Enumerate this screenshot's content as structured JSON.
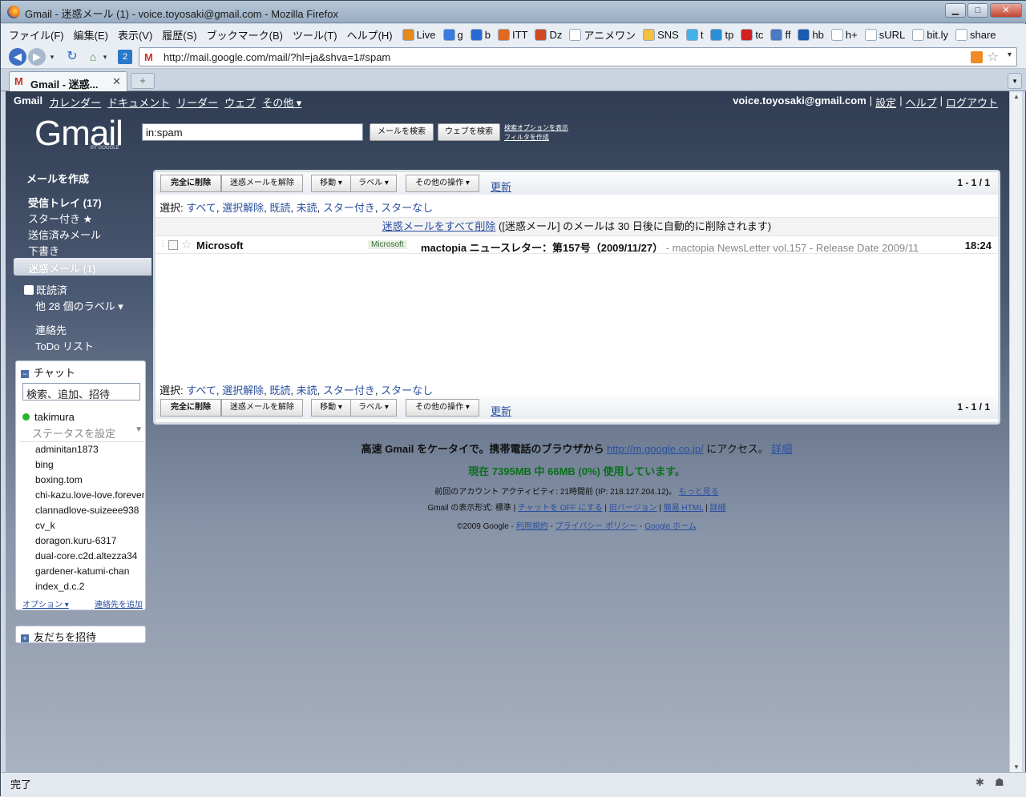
{
  "window": {
    "title": "Gmail - 迷惑メール (1) - voice.toyosaki@gmail.com - Mozilla Firefox",
    "min": "▁",
    "max": "□",
    "close": "✕"
  },
  "menu": {
    "items": [
      "ファイル(F)",
      "編集(E)",
      "表示(V)",
      "履歴(S)",
      "ブックマーク(B)",
      "ツール(T)",
      "ヘルプ(H)"
    ],
    "bookmarks": [
      {
        "label": "Live",
        "color": "#e58a1a"
      },
      {
        "label": "g",
        "color": "#3a7be0"
      },
      {
        "label": "b",
        "color": "#2a6ad6"
      },
      {
        "label": "ITT",
        "color": "#e06a22"
      },
      {
        "label": "Dz",
        "color": "#d04a20"
      },
      {
        "label": "アニメワン",
        "color": "#ffffff"
      },
      {
        "label": "SNS",
        "color": "#f0c040"
      },
      {
        "label": "t",
        "color": "#44b0e8"
      },
      {
        "label": "tp",
        "color": "#2a90d8"
      },
      {
        "label": "tc",
        "color": "#d02020"
      },
      {
        "label": "ff",
        "color": "#4a7ac0"
      },
      {
        "label": "hb",
        "color": "#1a5ab0"
      },
      {
        "label": "h+",
        "color": "#ffffff"
      },
      {
        "label": "sURL",
        "color": "#ffffff"
      },
      {
        "label": "bit.ly",
        "color": "#ffffff"
      },
      {
        "label": "share",
        "color": "#ffffff"
      }
    ]
  },
  "nav": {
    "url": "http://mail.google.com/mail/?hl=ja&shva=1#spam",
    "favicon": "M"
  },
  "tab": {
    "label": "Gmail - 迷惑...",
    "close": "✕",
    "new": "+"
  },
  "gmail": {
    "topnav": [
      "Gmail",
      "カレンダー",
      "ドキュメント",
      "リーダー",
      "ウェブ",
      "その他 ▾"
    ],
    "email": "voice.toyosaki@gmail.com",
    "toplinks": [
      "設定",
      "ヘルプ",
      "ログアウト"
    ],
    "logo": "Gmail",
    "logo_sub": "BY GOOGLE",
    "search_value": "in:spam",
    "search_mail_btn": "メールを検索",
    "search_web_btn": "ウェブを検索",
    "search_options": "検索オプションを表示",
    "create_filter": "フィルタを作成"
  },
  "sidebar": {
    "compose": "メールを作成",
    "inbox": "受信トレイ (17)",
    "starred": "スター付き ★",
    "sent": "送信済みメール",
    "drafts": "下書き",
    "spam": "迷惑メール (1)",
    "label_read": "既読済",
    "more_labels": "他 28 個のラベル ▾",
    "contacts": "連絡先",
    "todo": "ToDo リスト"
  },
  "chat": {
    "title": "チャット",
    "search_value": "検索、追加、招待",
    "me": "takimura",
    "status": "ステータスを設定",
    "contacts": [
      "adminitan1873",
      "bing",
      "boxing.tom",
      "chi-kazu.love-love.forever",
      "clannadlove-suizeee938",
      "cv_k",
      "doragon.kuru-6317",
      "dual-core.c2d.altezza34",
      "gardener-katumi-chan",
      "index_d.c.2"
    ],
    "options": "オプション ▾",
    "add_contact": "連絡先を追加",
    "invite": "友だちを招待"
  },
  "toolbar": {
    "delete_forever": "完全に削除",
    "not_spam": "迷惑メールを解除",
    "move": "移動 ▾",
    "label": "ラベル ▾",
    "more_actions": "その他の操作 ▾",
    "refresh": "更新",
    "page_count": "1 - 1 / 1"
  },
  "select": {
    "prefix": "選択:",
    "links": [
      "すべて",
      "選択解除",
      "既読",
      "未読",
      "スター付き",
      "スターなし"
    ]
  },
  "notice": {
    "link": "迷惑メールをすべて削除",
    "text": "([迷惑メール] のメールは 30 日後に自動的に削除されます)"
  },
  "message": {
    "from": "Microsoft",
    "label": "Microsoft",
    "subject": "mactopia ニュースレター：第157号（2009/11/27）",
    "snippet": " - mactopia NewsLetter vol.157 - Release Date 2009/11",
    "time": "18:24"
  },
  "footer": {
    "mobile_text": "高速 Gmail をケータイで。携帯電話のブラウザから",
    "mobile_link": "http://m.google.co.jp/",
    "mobile_text2": "にアクセス。",
    "mobile_more": "詳細",
    "usage": "現在 7395MB 中 66MB (0%) 使用しています。",
    "activity": "前回のアカウント アクティビティ: 21時間前 (IP: 218.127.204.12)。",
    "activity_more": "もっと見る",
    "view_label": "Gmail の表示形式: 標準 |",
    "view_chat_off": "チャットを OFF にする",
    "view_old": "旧バージョン",
    "view_html": "簡易 HTML",
    "view_detail": "詳細",
    "copyright": "©2009 Google -",
    "terms": "利用規約",
    "privacy": "プライバシー ポリシー",
    "home": "Google ホーム"
  },
  "statusbar": {
    "text": "完了"
  }
}
